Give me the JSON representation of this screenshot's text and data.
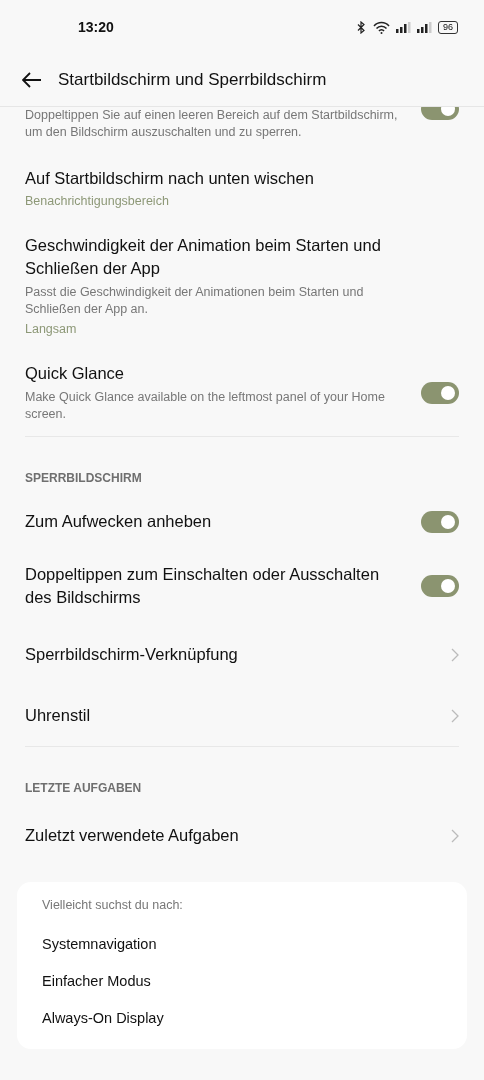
{
  "status_bar": {
    "time": "13:20",
    "battery": "96"
  },
  "header": {
    "title": "Startbildschirm und Sperrbildschirm"
  },
  "sections": [
    {
      "items": [
        {
          "kind": "toggle",
          "description": "Doppeltippen Sie auf einen leeren Bereich auf dem Startbildschirm, um den Bildschirm auszuschalten und zu sperren.",
          "on": true
        },
        {
          "kind": "value",
          "title": "Auf Startbildschirm nach unten wischen",
          "value": "Benachrichtigungsbereich"
        },
        {
          "kind": "value",
          "title": "Geschwindigkeit der Animation beim Starten und Schließen der App",
          "description": "Passt die Geschwindigkeit der Animationen beim Starten und Schließen der App an.",
          "value": "Langsam"
        },
        {
          "kind": "toggle",
          "title": "Quick Glance",
          "description": "Make Quick Glance available on the leftmost panel of your Home screen.",
          "on": true
        }
      ]
    },
    {
      "heading": "SPERRBILDSCHIRM",
      "items": [
        {
          "kind": "toggle",
          "title": "Zum Aufwecken anheben",
          "on": true
        },
        {
          "kind": "toggle",
          "title": "Doppeltippen zum Einschalten oder Ausschalten des Bildschirms",
          "on": true
        },
        {
          "kind": "link",
          "title": "Sperrbildschirm-Verknüpfung"
        },
        {
          "kind": "link",
          "title": "Uhrenstil"
        }
      ]
    },
    {
      "heading": "LETZTE AUFGABEN",
      "items": [
        {
          "kind": "link",
          "title": "Zuletzt verwendete Aufgaben"
        }
      ]
    }
  ],
  "suggestions": {
    "heading": "Vielleicht suchst du nach:",
    "items": [
      "Systemnavigation",
      "Einfacher Modus",
      "Always-On Display"
    ]
  }
}
